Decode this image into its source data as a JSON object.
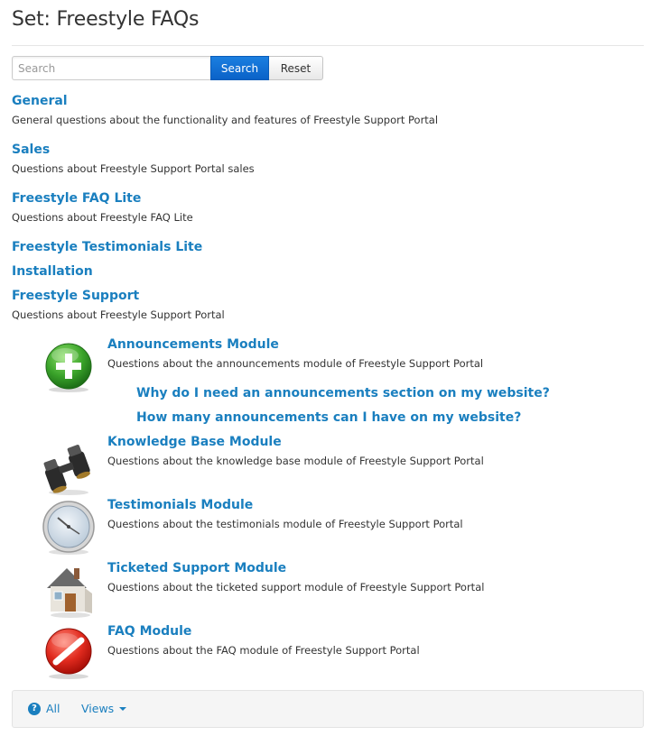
{
  "page": {
    "title": "Set: Freestyle FAQs"
  },
  "search": {
    "placeholder": "Search",
    "value": "",
    "search_label": "Search",
    "reset_label": "Reset"
  },
  "categories": [
    {
      "title": "General",
      "description": "General questions about the functionality and features of Freestyle Support Portal"
    },
    {
      "title": "Sales",
      "description": "Questions about Freestyle Support Portal sales"
    },
    {
      "title": "Freestyle FAQ Lite",
      "description": "Questions about Freestyle FAQ Lite"
    },
    {
      "title": "Freestyle Testimonials Lite",
      "description": ""
    },
    {
      "title": "Installation",
      "description": ""
    },
    {
      "title": "Freestyle Support",
      "description": "Questions about Freestyle Support Portal"
    }
  ],
  "subcategories": [
    {
      "title": "Announcements Module",
      "description": "Questions about the announcements module of Freestyle Support Portal",
      "icon": "plus-icon",
      "questions": [
        "Why do I need an announcements section on my website?",
        "How many announcements can I have on my website?"
      ]
    },
    {
      "title": "Knowledge Base Module",
      "description": "Questions about the knowledge base module of Freestyle Support Portal",
      "icon": "binoculars-icon"
    },
    {
      "title": "Testimonials Module",
      "description": "Questions about the testimonials module of Freestyle Support Portal",
      "icon": "clock-icon"
    },
    {
      "title": "Ticketed Support Module",
      "description": "Questions about the ticketed support module of Freestyle Support Portal",
      "icon": "house-icon"
    },
    {
      "title": "FAQ Module",
      "description": "Questions about the FAQ module of Freestyle Support Portal",
      "icon": "no-entry-icon"
    }
  ],
  "footer": {
    "all_label": "All",
    "views_label": "Views"
  },
  "colors": {
    "link": "#1a7fbf",
    "primary_button": "#0a62c8"
  }
}
